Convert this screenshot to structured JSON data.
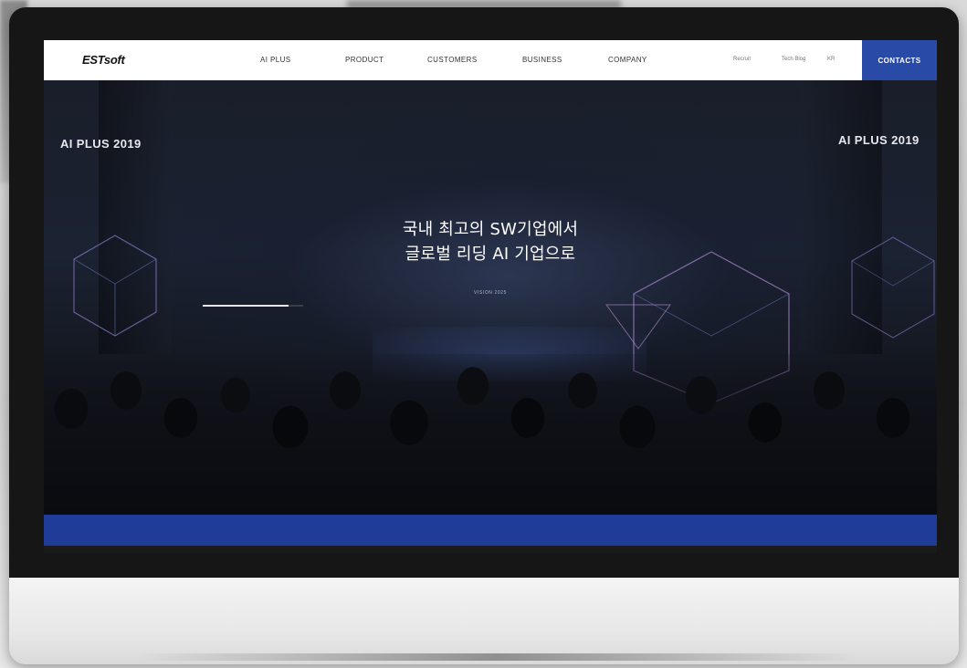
{
  "navbar": {
    "logo": "ESTsoft",
    "items": [
      "AI PLUS",
      "PRODUCT",
      "CUSTOMERS",
      "BUSINESS",
      "COMPANY"
    ],
    "utility": [
      "Recruit",
      "Tech Blog",
      "KR"
    ],
    "contacts_label": "CONTACTS"
  },
  "hero": {
    "left_title": "AI PLUS 2019",
    "left_subtitle": "",
    "right_title": "AI PLUS 2019",
    "right_subtitle": "",
    "top_info_col1": "",
    "top_info_col2": "",
    "headline_line1": "국내 최고의 SW기업에서",
    "headline_line2": "글로벌 리딩 AI 기업으로",
    "vision_label": "VISION 2025",
    "description": "",
    "slide_label": "",
    "slide_progress": 0.85
  },
  "colors": {
    "accent": "#2a4aa8",
    "band": "#1f3c98",
    "shape_line": "#9a7fd4"
  }
}
